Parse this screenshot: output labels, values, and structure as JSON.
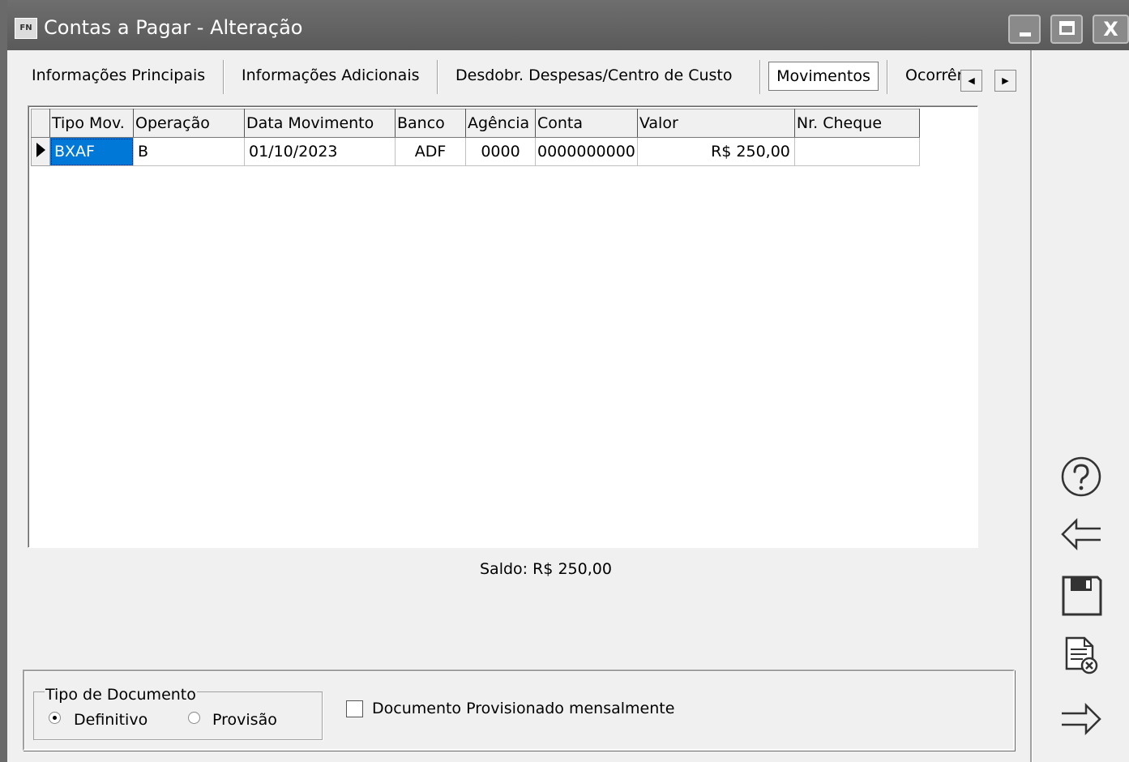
{
  "window": {
    "app_icon": "FN",
    "title": "Contas a Pagar - Alteração",
    "controls": {
      "minimize": "minimize-icon",
      "maximize": "maximize-icon",
      "close": "X"
    }
  },
  "tabs": [
    {
      "label": "Informações Principais",
      "active": false
    },
    {
      "label": "Informações Adicionais",
      "active": false
    },
    {
      "label": "Desdobr. Despesas/Centro de Custo",
      "active": false
    },
    {
      "label": "Movimentos",
      "active": true
    },
    {
      "label": "Ocorrências",
      "active": false
    }
  ],
  "grid": {
    "columns": [
      "Tipo Mov.",
      "Operação",
      "Data Movimento",
      "Banco",
      "Agência",
      "Conta",
      "Valor",
      "Nr. Cheque"
    ],
    "rows": [
      {
        "tipo_mov": "BXAF",
        "operacao": "B",
        "data_movimento": "01/10/2023",
        "banco": "ADF",
        "agencia": "0000",
        "conta": "0000000000",
        "valor": "R$ 250,00",
        "nr_cheque": ""
      }
    ]
  },
  "saldo": "Saldo: R$ 250,00",
  "tipo_documento": {
    "legend": "Tipo de Documento",
    "options": [
      {
        "label": "Definitivo",
        "selected": true
      },
      {
        "label": "Provisão",
        "selected": false
      }
    ]
  },
  "provisionado_checkbox": {
    "label": "Documento Provisionado mensalmente",
    "checked": false
  },
  "sidebar_icons": [
    "help-icon",
    "back-arrow-icon",
    "save-icon",
    "cancel-document-icon",
    "forward-arrow-icon"
  ],
  "colors": {
    "titlebar": "#5f5f5f",
    "selection": "#0078d7",
    "background": "#f0f0f0"
  }
}
